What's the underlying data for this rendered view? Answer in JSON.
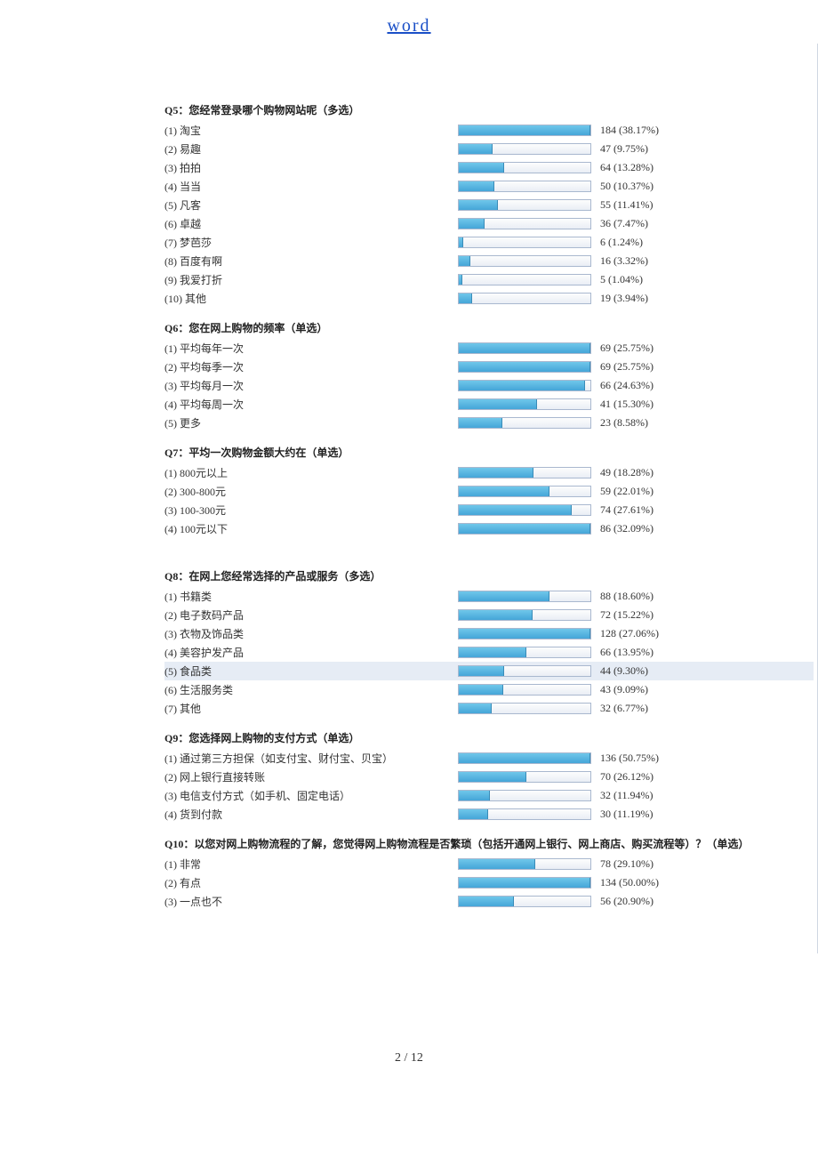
{
  "header": {
    "link_text": "word"
  },
  "footer": {
    "page": "2 / 12"
  },
  "questions": [
    {
      "title": "Q5：您经常登录哪个购物网站呢（多选）",
      "max_pct": 38.17,
      "options": [
        {
          "label": "(1) 淘宝",
          "count": 184,
          "pct": "38.17%"
        },
        {
          "label": "(2) 易趣",
          "count": 47,
          "pct": "9.75%"
        },
        {
          "label": "(3) 拍拍",
          "count": 64,
          "pct": "13.28%"
        },
        {
          "label": "(4) 当当",
          "count": 50,
          "pct": "10.37%"
        },
        {
          "label": "(5) 凡客",
          "count": 55,
          "pct": "11.41%"
        },
        {
          "label": "(6) 卓越",
          "count": 36,
          "pct": "7.47%"
        },
        {
          "label": "(7) 梦芭莎",
          "count": 6,
          "pct": "1.24%"
        },
        {
          "label": "(8) 百度有啊",
          "count": 16,
          "pct": "3.32%"
        },
        {
          "label": "(9) 我爱打折",
          "count": 5,
          "pct": "1.04%"
        },
        {
          "label": "(10) 其他",
          "count": 19,
          "pct": "3.94%"
        }
      ]
    },
    {
      "title": "Q6：您在网上购物的频率（单选）",
      "max_pct": 25.75,
      "options": [
        {
          "label": "(1) 平均每年一次",
          "count": 69,
          "pct": "25.75%"
        },
        {
          "label": "(2) 平均每季一次",
          "count": 69,
          "pct": "25.75%"
        },
        {
          "label": "(3) 平均每月一次",
          "count": 66,
          "pct": "24.63%"
        },
        {
          "label": "(4) 平均每周一次",
          "count": 41,
          "pct": "15.30%"
        },
        {
          "label": "(5) 更多",
          "count": 23,
          "pct": "8.58%"
        }
      ]
    },
    {
      "title": "Q7：平均一次购物金额大约在（单选）",
      "max_pct": 32.09,
      "options": [
        {
          "label": "(1) 800元以上",
          "count": 49,
          "pct": "18.28%"
        },
        {
          "label": "(2) 300-800元",
          "count": 59,
          "pct": "22.01%"
        },
        {
          "label": "(3) 100-300元",
          "count": 74,
          "pct": "27.61%"
        },
        {
          "label": "(4) 100元以下",
          "count": 86,
          "pct": "32.09%"
        }
      ]
    },
    {
      "title": "Q8：在网上您经常选择的产品或服务（多选）",
      "max_pct": 27.06,
      "gap_before": true,
      "options": [
        {
          "label": "(1) 书籍类",
          "count": 88,
          "pct": "18.60%"
        },
        {
          "label": "(2) 电子数码产品",
          "count": 72,
          "pct": "15.22%"
        },
        {
          "label": "(3) 衣物及饰品类",
          "count": 128,
          "pct": "27.06%"
        },
        {
          "label": "(4) 美容护发产品",
          "count": 66,
          "pct": "13.95%"
        },
        {
          "label": "(5) 食品类",
          "count": 44,
          "pct": "9.30%",
          "highlight": true
        },
        {
          "label": "(6) 生活服务类",
          "count": 43,
          "pct": "9.09%"
        },
        {
          "label": "(7) 其他",
          "count": 32,
          "pct": "6.77%"
        }
      ]
    },
    {
      "title": "Q9：您选择网上购物的支付方式（单选）",
      "max_pct": 50.75,
      "options": [
        {
          "label": "(1) 通过第三方担保（如支付宝、财付宝、贝宝）",
          "count": 136,
          "pct": "50.75%"
        },
        {
          "label": "(2) 网上银行直接转账",
          "count": 70,
          "pct": "26.12%"
        },
        {
          "label": "(3) 电信支付方式（如手机、固定电话）",
          "count": 32,
          "pct": "11.94%"
        },
        {
          "label": "(4) 货到付款",
          "count": 30,
          "pct": "11.19%"
        }
      ]
    },
    {
      "title": "Q10：以您对网上购物流程的了解，您觉得网上购物流程是否繁琐（包括开通网上银行、网上商店、购买流程等）？（单选）",
      "max_pct": 50.0,
      "options": [
        {
          "label": "(1) 非常",
          "count": 78,
          "pct": "29.10%"
        },
        {
          "label": "(2) 有点",
          "count": 134,
          "pct": "50.00%"
        },
        {
          "label": "(3) 一点也不",
          "count": 56,
          "pct": "20.90%"
        }
      ]
    }
  ]
}
